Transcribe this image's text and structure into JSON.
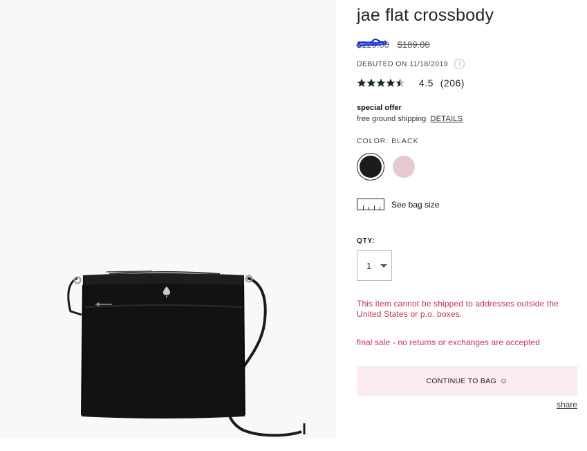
{
  "product": {
    "title": "jae flat crossbody",
    "sale_price_obscured": "$129.00",
    "list_price": "$189.00",
    "debut_text": "DEBUTED ON 11/18/2019",
    "help_icon_glyph": "?",
    "rating": {
      "stars": 4.5,
      "value": "4.5",
      "count": "(206)"
    }
  },
  "offer": {
    "title": "special offer",
    "text": "free ground shipping",
    "link": "DETAILS"
  },
  "color": {
    "label": "COLOR: BLACK",
    "swatches": [
      {
        "name": "black",
        "hex": "#1c1c1c",
        "selected": true
      },
      {
        "name": "pink",
        "hex": "#e8c8cf",
        "selected": false
      }
    ]
  },
  "bag_size": {
    "label": "See bag size"
  },
  "quantity": {
    "label": "QTY:",
    "value": "1"
  },
  "notices": {
    "shipping_warning": "This item cannot be shipped to addresses outside the United States or p.o. boxes.",
    "final_sale": "final sale - no returns or exchanges are accepted"
  },
  "cta": {
    "label": "CONTINUE TO BAG",
    "icon": "smiley-icon"
  },
  "share": {
    "label": "share"
  },
  "colors": {
    "accent_red": "#d0324a",
    "cta_background": "#fbecef",
    "image_background": "#f8f8f8"
  }
}
